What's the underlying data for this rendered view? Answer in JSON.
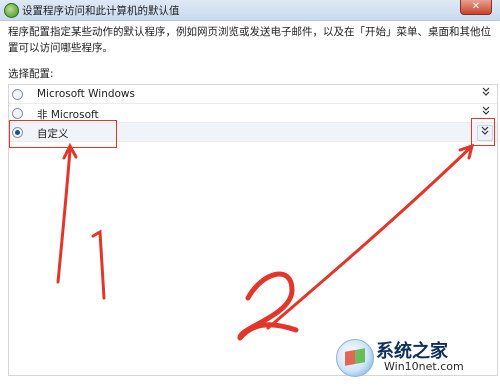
{
  "window": {
    "title": "设置程序访问和此计算机的默认值",
    "close_symbol": "✕"
  },
  "description": "程序配置指定某些动作的默认程序，例如网页浏览或发送电子邮件，以及在「开始」菜单、桌面和其他位置可以访问哪些程序。",
  "section_label": "选择配置:",
  "options": [
    {
      "label": "Microsoft Windows",
      "selected": false,
      "expand_icon": "double-chevron-down-icon"
    },
    {
      "label": "非 Microsoft",
      "selected": false,
      "expand_icon": "double-chevron-down-icon"
    },
    {
      "label": "自定义",
      "selected": true,
      "expand_icon": "double-chevron-down-icon"
    }
  ],
  "expand_glyph": "»",
  "annotations": {
    "color": "#e2362b",
    "marks": [
      "1",
      "2"
    ]
  },
  "watermark": {
    "name": "系统之家",
    "url": "Win10net.com"
  }
}
